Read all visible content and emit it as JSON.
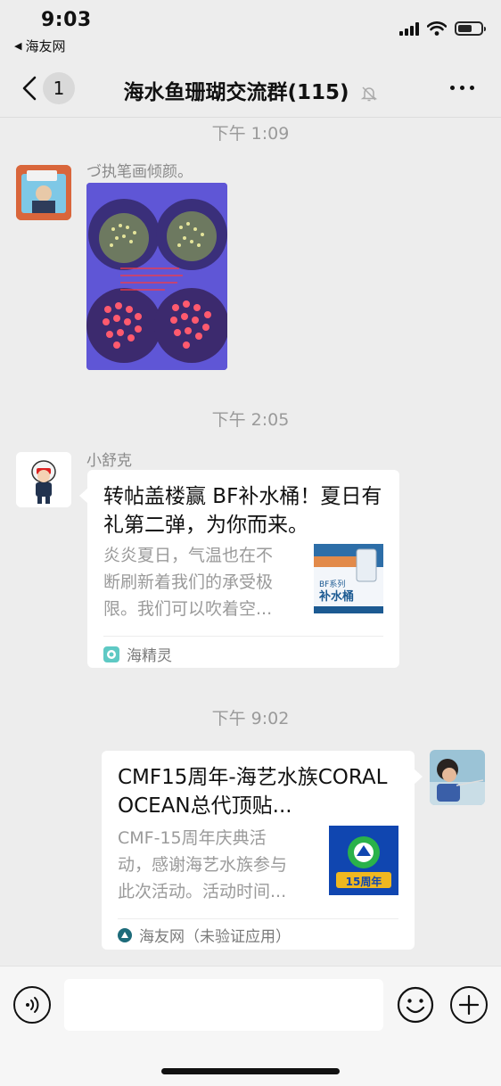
{
  "status_bar": {
    "time": "9:03",
    "back_app": "海友网"
  },
  "nav": {
    "badge_count": "1",
    "title": "海水鱼珊瑚交流群(115)"
  },
  "messages": [
    {
      "timestamp": "下午 1:09",
      "sender": "づ执笔画倾颜。",
      "type": "image"
    },
    {
      "timestamp": "下午 2:05",
      "sender": "小舒克",
      "type": "link",
      "title": "转帖盖楼赢 BF补水桶！夏日有礼第二弹，为你而来。",
      "desc": "炎炎夏日，气温也在不断刷新着我们的承受极限。我们可以吹着空...",
      "thumb_text": "补水桶",
      "thumb_subtext": "BF系列",
      "source": "海精灵"
    },
    {
      "timestamp": "下午 9:02",
      "type": "link",
      "title": "CMF15周年-海艺水族CORAL OCEAN总代顶贴...",
      "desc": "CMF-15周年庆典活动，感谢海艺水族参与此次活动。活动时间...",
      "thumb_text": "15周年",
      "source": "海友网（未验证应用）"
    }
  ],
  "colors": {
    "background": "#ededed",
    "card": "#ffffff",
    "muted_text": "#9a9a9a"
  }
}
